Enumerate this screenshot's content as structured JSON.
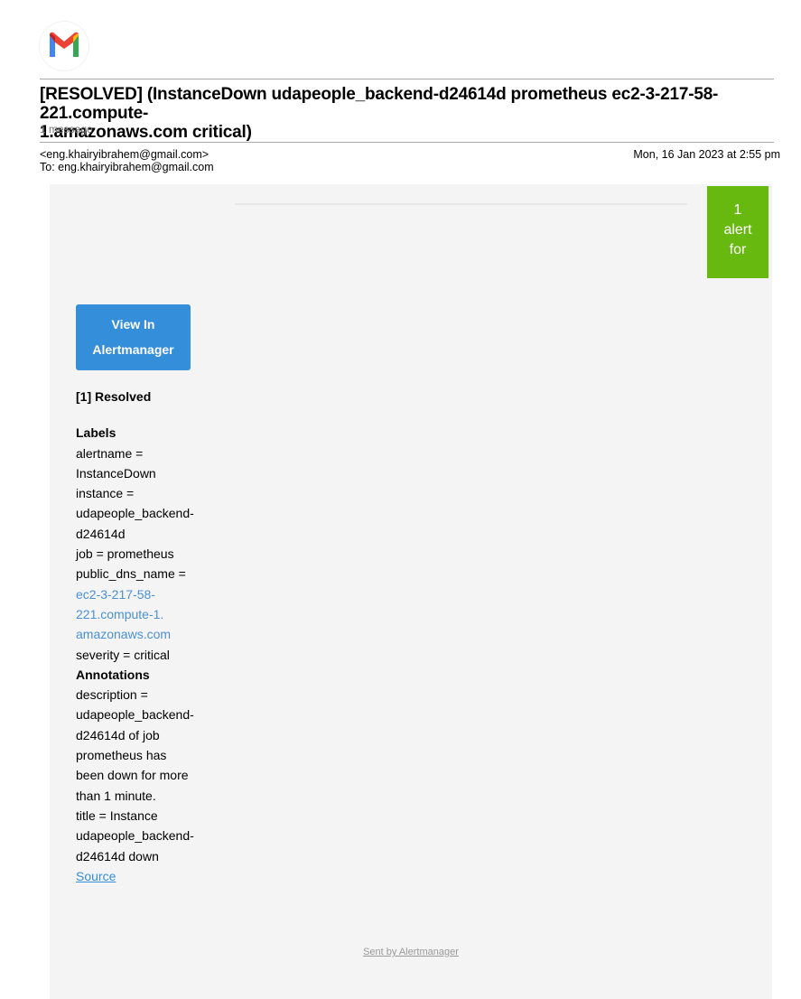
{
  "email": {
    "subject_line_1": "[RESOLVED] (InstanceDown udapeople_backend-d24614d prometheus ec2-3-217-58-221.compute-",
    "subject_line_2": "1.amazonaws.com critical)",
    "message_count": "1 message",
    "from": "<eng.khairyibrahem@gmail.com>",
    "to": "To: eng.khairyibrahem@gmail.com",
    "date": "Mon, 16 Jan 2023 at 2:55 pm"
  },
  "alert_box": {
    "line1": "1",
    "line2": "alert",
    "line3": "for",
    "color": "#68b90f"
  },
  "button": {
    "line1": "View In",
    "line2": "Alertmanager",
    "color": "#348eda"
  },
  "alert": {
    "heading": "[1] Resolved",
    "labels_heading": "Labels",
    "labels": [
      "alertname =",
      "InstanceDown",
      "instance =",
      "udapeople_backend-",
      "d24614d",
      "job = prometheus",
      "public_dns_name ="
    ],
    "dns_link": [
      "ec2-3-217-58-",
      "221.compute-1.",
      "amazonaws.com"
    ],
    "severity": "severity = critical",
    "annotations_heading": "Annotations",
    "annotations": [
      "description =",
      "udapeople_backend-",
      "d24614d of job",
      "prometheus has",
      "been down for more",
      "than 1 minute.",
      "title = Instance",
      "udapeople_backend-",
      "d24614d down"
    ],
    "source_link": "Source"
  },
  "footer": {
    "text": "Sent by Alertmanager"
  }
}
